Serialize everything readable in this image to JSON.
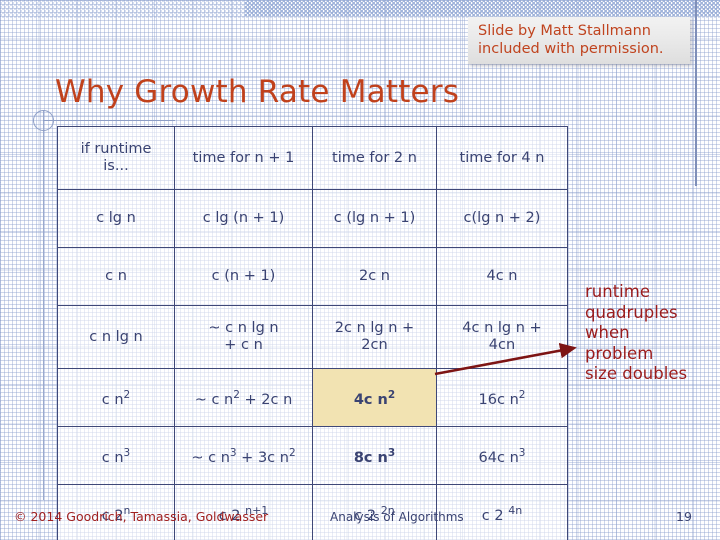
{
  "slide": {
    "title": "Why Growth Rate Matters",
    "credit": {
      "line1": "Slide by Matt Stallmann",
      "line2": "included with permission."
    },
    "annotation": {
      "line1": "runtime",
      "line2": "quadruples",
      "line3": "when",
      "line4": "problem",
      "line5": "size doubles"
    },
    "footer": {
      "copyright": "© 2014 Goodrich, Tamassia, Goldwasser",
      "center": "Analysis of Algorithms",
      "page": "19"
    },
    "colors": {
      "title": "#c0411c",
      "credit_text": "#c0441f",
      "table_border": "#3f4878",
      "table_text": "#3a4372",
      "highlight_cell": "#f2e3b2",
      "arrow": "#7d1414",
      "annotation": "#9b1c1c",
      "footer_copyright": "#a02020",
      "grid": "#8ca0cd"
    }
  },
  "chart_data": {
    "type": "table",
    "title": "Why Growth Rate Matters",
    "columns": [
      "if runtime is...",
      "time for n + 1",
      "time for 2 n",
      "time for 4 n"
    ],
    "header_cells": [
      {
        "text_line1": "if runtime",
        "text_line2": "is..."
      },
      {
        "text_line1": "time for n + 1"
      },
      {
        "text_line1": "time for 2 n"
      },
      {
        "text_line1": "time for 4 n"
      }
    ],
    "rows": [
      {
        "runtime": "c lg n",
        "n_plus_1": "c lg (n + 1)",
        "two_n": "c (lg n + 1)",
        "four_n": "c(lg n + 2)"
      },
      {
        "runtime": "c n",
        "n_plus_1": "c (n + 1)",
        "two_n": "2c n",
        "four_n": "4c n"
      },
      {
        "runtime": "c n lg n",
        "n_plus_1_line1": "~ c n lg n",
        "n_plus_1_line2": "+ c n",
        "two_n_line1": "2c n lg n +",
        "two_n_line2": "2cn",
        "four_n_line1": "4c n lg n +",
        "four_n_line2": "4cn"
      },
      {
        "runtime_base": "c n",
        "runtime_sup": "2",
        "n_plus_1_a": "~ c n",
        "n_plus_1_sup": "2",
        "n_plus_1_b": " + 2c n",
        "two_n_base": "4c n",
        "two_n_sup": "2",
        "four_n_base": "16c n",
        "four_n_sup": "2"
      },
      {
        "runtime_base": "c n",
        "runtime_sup": "3",
        "n_plus_1_a": "~ c n",
        "n_plus_1_sup1": "3",
        "n_plus_1_b": " + 3c n",
        "n_plus_1_sup2": "2",
        "two_n_base": "8c n",
        "two_n_sup": "3",
        "four_n_base": "64c n",
        "four_n_sup": "3"
      },
      {
        "runtime_base": "c 2",
        "runtime_sup": "n",
        "n_plus_1_base": "c 2 ",
        "n_plus_1_sup": "n+1",
        "two_n_base": "c 2 ",
        "two_n_sup": "2n",
        "four_n_base": "c 2 ",
        "four_n_sup": "4n"
      }
    ],
    "highlighted_cell": {
      "row": 4,
      "column": "time for 2 n",
      "value": "4c n²"
    },
    "bold_cells": [
      {
        "row": 4,
        "column": "time for 2 n",
        "value": "4c n²"
      },
      {
        "row": 5,
        "column": "time for 2 n",
        "value": "8c n³"
      }
    ],
    "annotation_text": "runtime quadruples when problem size doubles"
  }
}
